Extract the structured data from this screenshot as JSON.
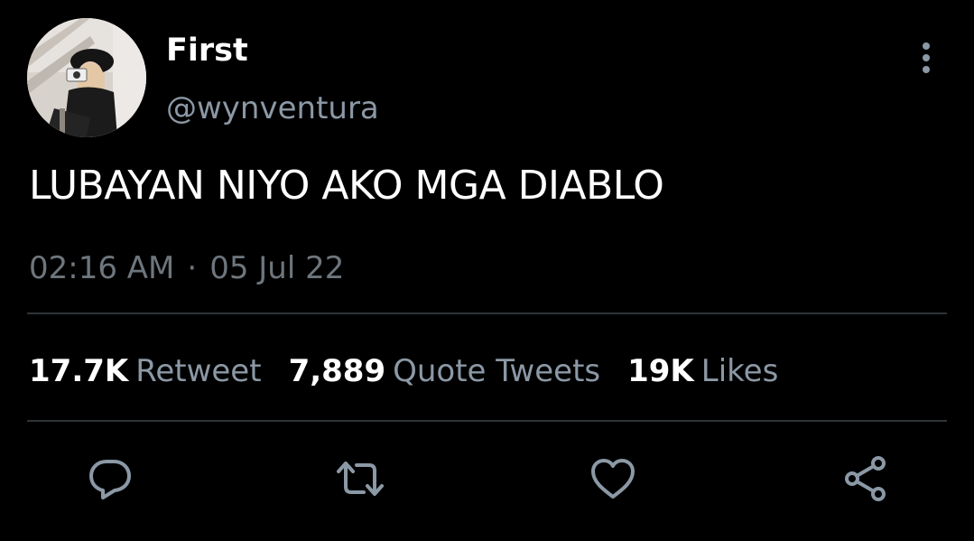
{
  "author": {
    "display_name": "First",
    "handle": "@wynventura"
  },
  "tweet": {
    "text": "LUBAYAN NIYO AKO MGA DIABLO",
    "time": "02:16 AM",
    "separator": "·",
    "date": "05 Jul 22"
  },
  "stats": [
    {
      "count": "17.7K",
      "label": "Retweet"
    },
    {
      "count": "7,889",
      "label": "Quote Tweets"
    },
    {
      "count": "19K",
      "label": "Likes"
    }
  ],
  "icons": {
    "more": "more-vertical-icon",
    "reply": "reply-icon",
    "retweet": "retweet-icon",
    "like": "heart-icon",
    "share": "share-icon"
  },
  "colors": {
    "background": "#000000",
    "text_primary": "#ffffff",
    "text_secondary": "#8b98a5",
    "text_meta": "#6e767d",
    "divider": "#2f3336",
    "icon": "#8b98a5"
  }
}
